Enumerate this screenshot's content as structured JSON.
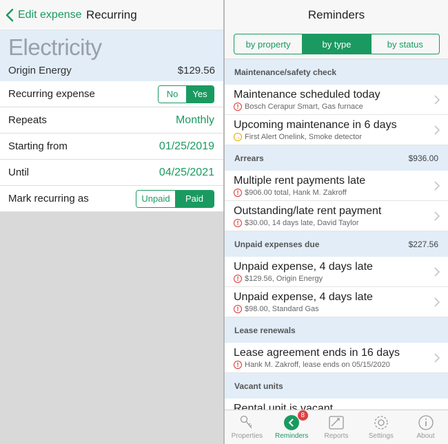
{
  "left": {
    "back_label": "Edit expense",
    "title": "Recurring",
    "hero": {
      "name": "Electricity",
      "vendor": "Origin Energy",
      "amount": "$129.56"
    },
    "rows": {
      "recurring_label": "Recurring expense",
      "recurring_no": "No",
      "recurring_yes": "Yes",
      "repeats_label": "Repeats",
      "repeats_value": "Monthly",
      "start_label": "Starting from",
      "start_value": "01/25/2019",
      "until_label": "Until",
      "until_value": "04/25/2021",
      "mark_label": "Mark recurring as",
      "mark_unpaid": "Unpaid",
      "mark_paid": "Paid"
    }
  },
  "right": {
    "title": "Reminders",
    "segments": [
      "by property",
      "by type",
      "by status"
    ],
    "sections": [
      {
        "title": "Maintenance/safety check",
        "amount": "",
        "items": [
          {
            "title": "Maintenance scheduled today",
            "sub": "Bosch Cerapur Smart, Gas furnace",
            "icon": "alert-icon"
          },
          {
            "title": "Upcoming maintenance in 6 days",
            "sub": "First Alert Onelink, Smoke detector",
            "icon": "arrow-icon"
          }
        ]
      },
      {
        "title": "Arrears",
        "amount": "$936.00",
        "items": [
          {
            "title": "Multiple rent payments late",
            "sub": "$906.00 total, Hank M. Zakroff",
            "icon": "alert-icon"
          },
          {
            "title": "Outstanding/late rent payment",
            "sub": "$30.00, 14 days late, David Taylor",
            "icon": "alert-icon"
          }
        ]
      },
      {
        "title": "Unpaid expenses due",
        "amount": "$227.56",
        "items": [
          {
            "title": "Unpaid expense, 4 days late",
            "sub": "$129.56, Origin Energy",
            "icon": "alert-icon"
          },
          {
            "title": "Unpaid expense, 4 days late",
            "sub": "$98.00, Standard Gas",
            "icon": "alert-icon"
          }
        ]
      },
      {
        "title": "Lease renewals",
        "amount": "",
        "items": [
          {
            "title": "Lease agreement ends in 16 days",
            "sub": "Hank M. Zakroff, lease ends on 05/15/2020",
            "icon": "alert-icon"
          }
        ]
      },
      {
        "title": "Vacant units",
        "amount": "",
        "items": [
          {
            "title": "Rental unit is vacant",
            "sub": "",
            "icon": "alert-icon"
          }
        ]
      }
    ],
    "tabs": [
      {
        "label": "Properties",
        "icon": "key-icon"
      },
      {
        "label": "Reminders",
        "icon": "reminders-icon",
        "badge": "8"
      },
      {
        "label": "Reports",
        "icon": "reports-icon"
      },
      {
        "label": "Settings",
        "icon": "gear-icon"
      },
      {
        "label": "About",
        "icon": "info-icon"
      }
    ],
    "accent": "#1a9a60"
  }
}
